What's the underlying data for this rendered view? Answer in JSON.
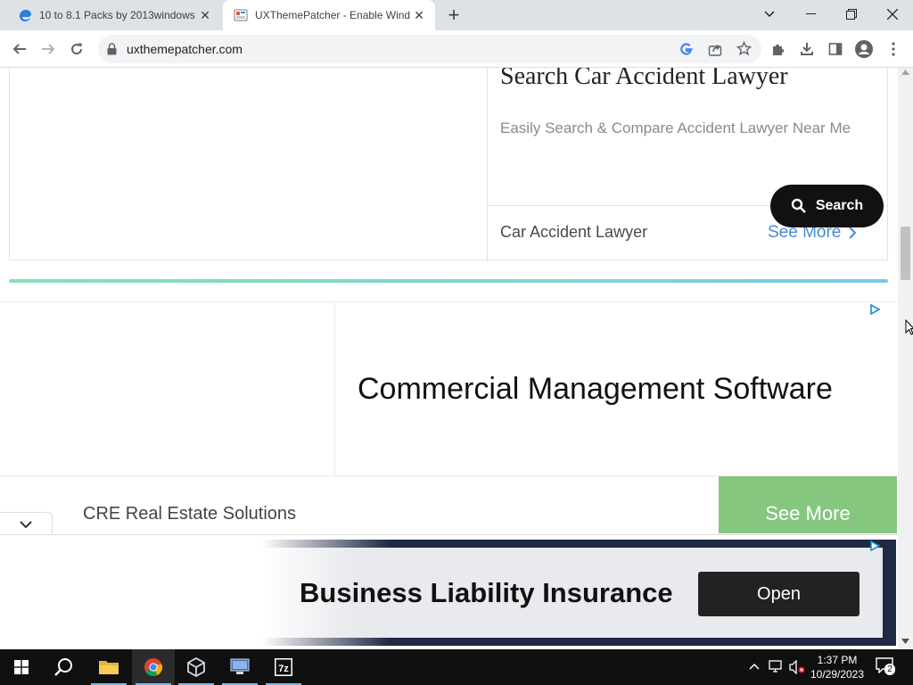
{
  "browser": {
    "tabs": [
      {
        "title": "10 to 8.1 Packs by 2013windows",
        "active": false
      },
      {
        "title": "UXThemePatcher - Enable Wind",
        "active": true
      }
    ],
    "url": "uxthemepatcher.com",
    "new_tab_symbol": "+"
  },
  "ad_car": {
    "title": "Search Car Accident Lawyer",
    "description": "Easily Search & Compare Accident Lawyer Near Me",
    "footer_label": "Car Accident Lawyer",
    "see_more": "See More",
    "search_button": "Search"
  },
  "ad_commercial": {
    "title": "Commercial Management Software",
    "row_label": "CRE Real Estate Solutions",
    "see_more": "See More"
  },
  "sticky_ad": {
    "title": "Business Liability Insurance",
    "button": "Open"
  },
  "taskbar": {
    "time": "1:37 PM",
    "date": "10/29/2023",
    "notification_count": "2",
    "apps": [
      "start-icon",
      "search-icon",
      "file-explorer-icon",
      "chrome-icon",
      "virtualbox-icon",
      "network-app-icon",
      "7zip-icon"
    ]
  },
  "colors": {
    "see_more_link": "#4a8ad4",
    "green_button": "#86c77f",
    "dark_button": "#222222",
    "taskbar": "#101010"
  }
}
